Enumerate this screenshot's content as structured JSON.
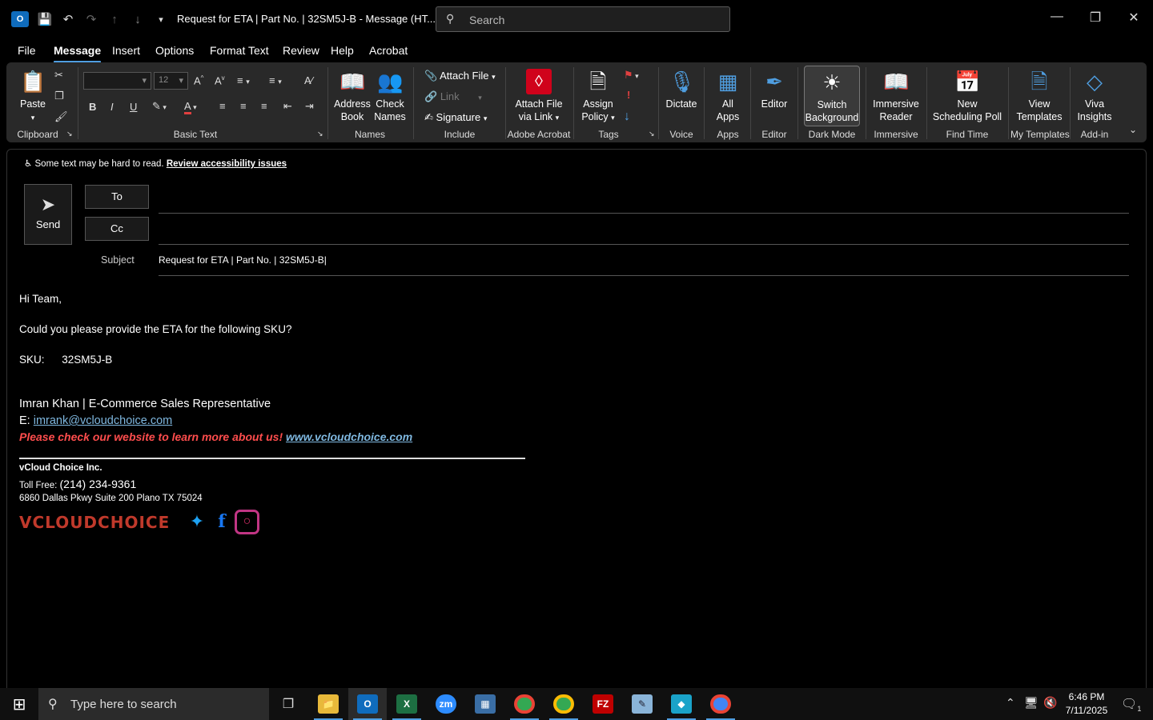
{
  "titlebar": {
    "title": "Request for ETA | Part No. | 32SM5J-B  -  Message (HT...",
    "search_placeholder": "Search",
    "app_icon": "outlook-icon"
  },
  "menu": {
    "items": [
      "File",
      "Message",
      "Insert",
      "Options",
      "Format Text",
      "Review",
      "Help",
      "Acrobat"
    ],
    "active": "Message"
  },
  "ribbon": {
    "clipboard": {
      "paste": "Paste",
      "group": "Clipboard"
    },
    "basic_text": {
      "font_size": "12",
      "group": "Basic Text"
    },
    "names": {
      "address_book": "Address Book",
      "check_names": "Check Names",
      "group": "Names"
    },
    "include": {
      "attach_file": "Attach File",
      "link": "Link",
      "signature": "Signature",
      "group": "Include"
    },
    "acrobat": {
      "attach_via_link": "Attach File via Link",
      "group": "Adobe Acrobat"
    },
    "tags": {
      "assign_policy": "Assign Policy",
      "group": "Tags"
    },
    "voice": {
      "dictate": "Dictate",
      "group": "Voice"
    },
    "apps": {
      "all_apps": "All Apps",
      "group": "Apps"
    },
    "editor": {
      "editor": "Editor",
      "group": "Editor"
    },
    "dark_mode": {
      "switch_bg": "Switch Background",
      "group": "Dark Mode"
    },
    "immersive": {
      "reader": "Immersive Reader",
      "group": "Immersive"
    },
    "find_time": {
      "poll": "New Scheduling Poll",
      "group": "Find Time"
    },
    "templates": {
      "view": "View Templates",
      "group": "My Templates"
    },
    "addin": {
      "viva": "Viva Insights",
      "group": "Add-in"
    }
  },
  "compose": {
    "a11y_text": "Some text may be hard to read.",
    "a11y_link": "Review accessibility issues",
    "send": "Send",
    "to": "To",
    "cc": "Cc",
    "subject_label": "Subject",
    "subject_value": "Request for ETA | Part No. | 32SM5J-B|"
  },
  "body": {
    "greeting": "Hi Team,",
    "line1": "Could you please provide the ETA for the following SKU?",
    "sku_label": "SKU:",
    "sku_value": "32SM5J-B"
  },
  "signature": {
    "name_line": "Imran Khan | E-Commerce Sales Representative",
    "email_label": "E:",
    "email": "imrank@vcloudchoice.com",
    "promo": "Please check our website to learn more about us!",
    "website": "www.vcloudchoice.com",
    "company": "vCloud Choice Inc.",
    "tollfree_label": "Toll Free:",
    "tollfree": "(214) 234-9361",
    "address": "6860 Dallas Pkwy Suite 200 Plano TX 75024",
    "logo_text": "VCLOUDCHOICE"
  },
  "taskbar": {
    "search_placeholder": "Type here to search",
    "time": "6:46 PM",
    "date": "7/11/2025",
    "notif_count": "1"
  }
}
